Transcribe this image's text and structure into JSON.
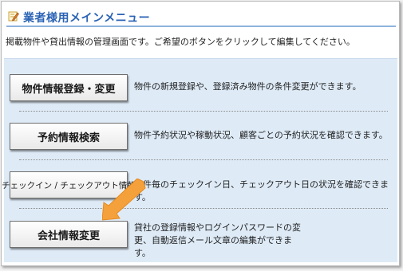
{
  "header": {
    "title": "業者様用メインメニュー",
    "icon": "edit-pencil-icon"
  },
  "intro_text": "掲載物件や貸出情報の管理画面です。ご希望のボタンをクリックして編集してください。",
  "menu": [
    {
      "label": "物件情報登録・変更",
      "description": "物件の新規登録や、登録済み物件の条件変更ができます。"
    },
    {
      "label": "予約情報検索",
      "description": "物件予約状況や稼動状況、顧客ごとの予約状況を確認できます。"
    },
    {
      "label": "チェックイン / チェックアウト情報",
      "description": "物件毎のチェックイン日、チェックアウト日の状況を確認できます。"
    },
    {
      "label": "会社情報変更",
      "description": "貸社の登録情報やログインパスワードの変更、自動返信メール文章の編集ができます。"
    }
  ],
  "colors": {
    "title": "#2a63b4",
    "content_bg": "#deebf7",
    "arrow": "#f5a13b"
  },
  "annotation": {
    "icon": "orange-arrow-icon"
  }
}
